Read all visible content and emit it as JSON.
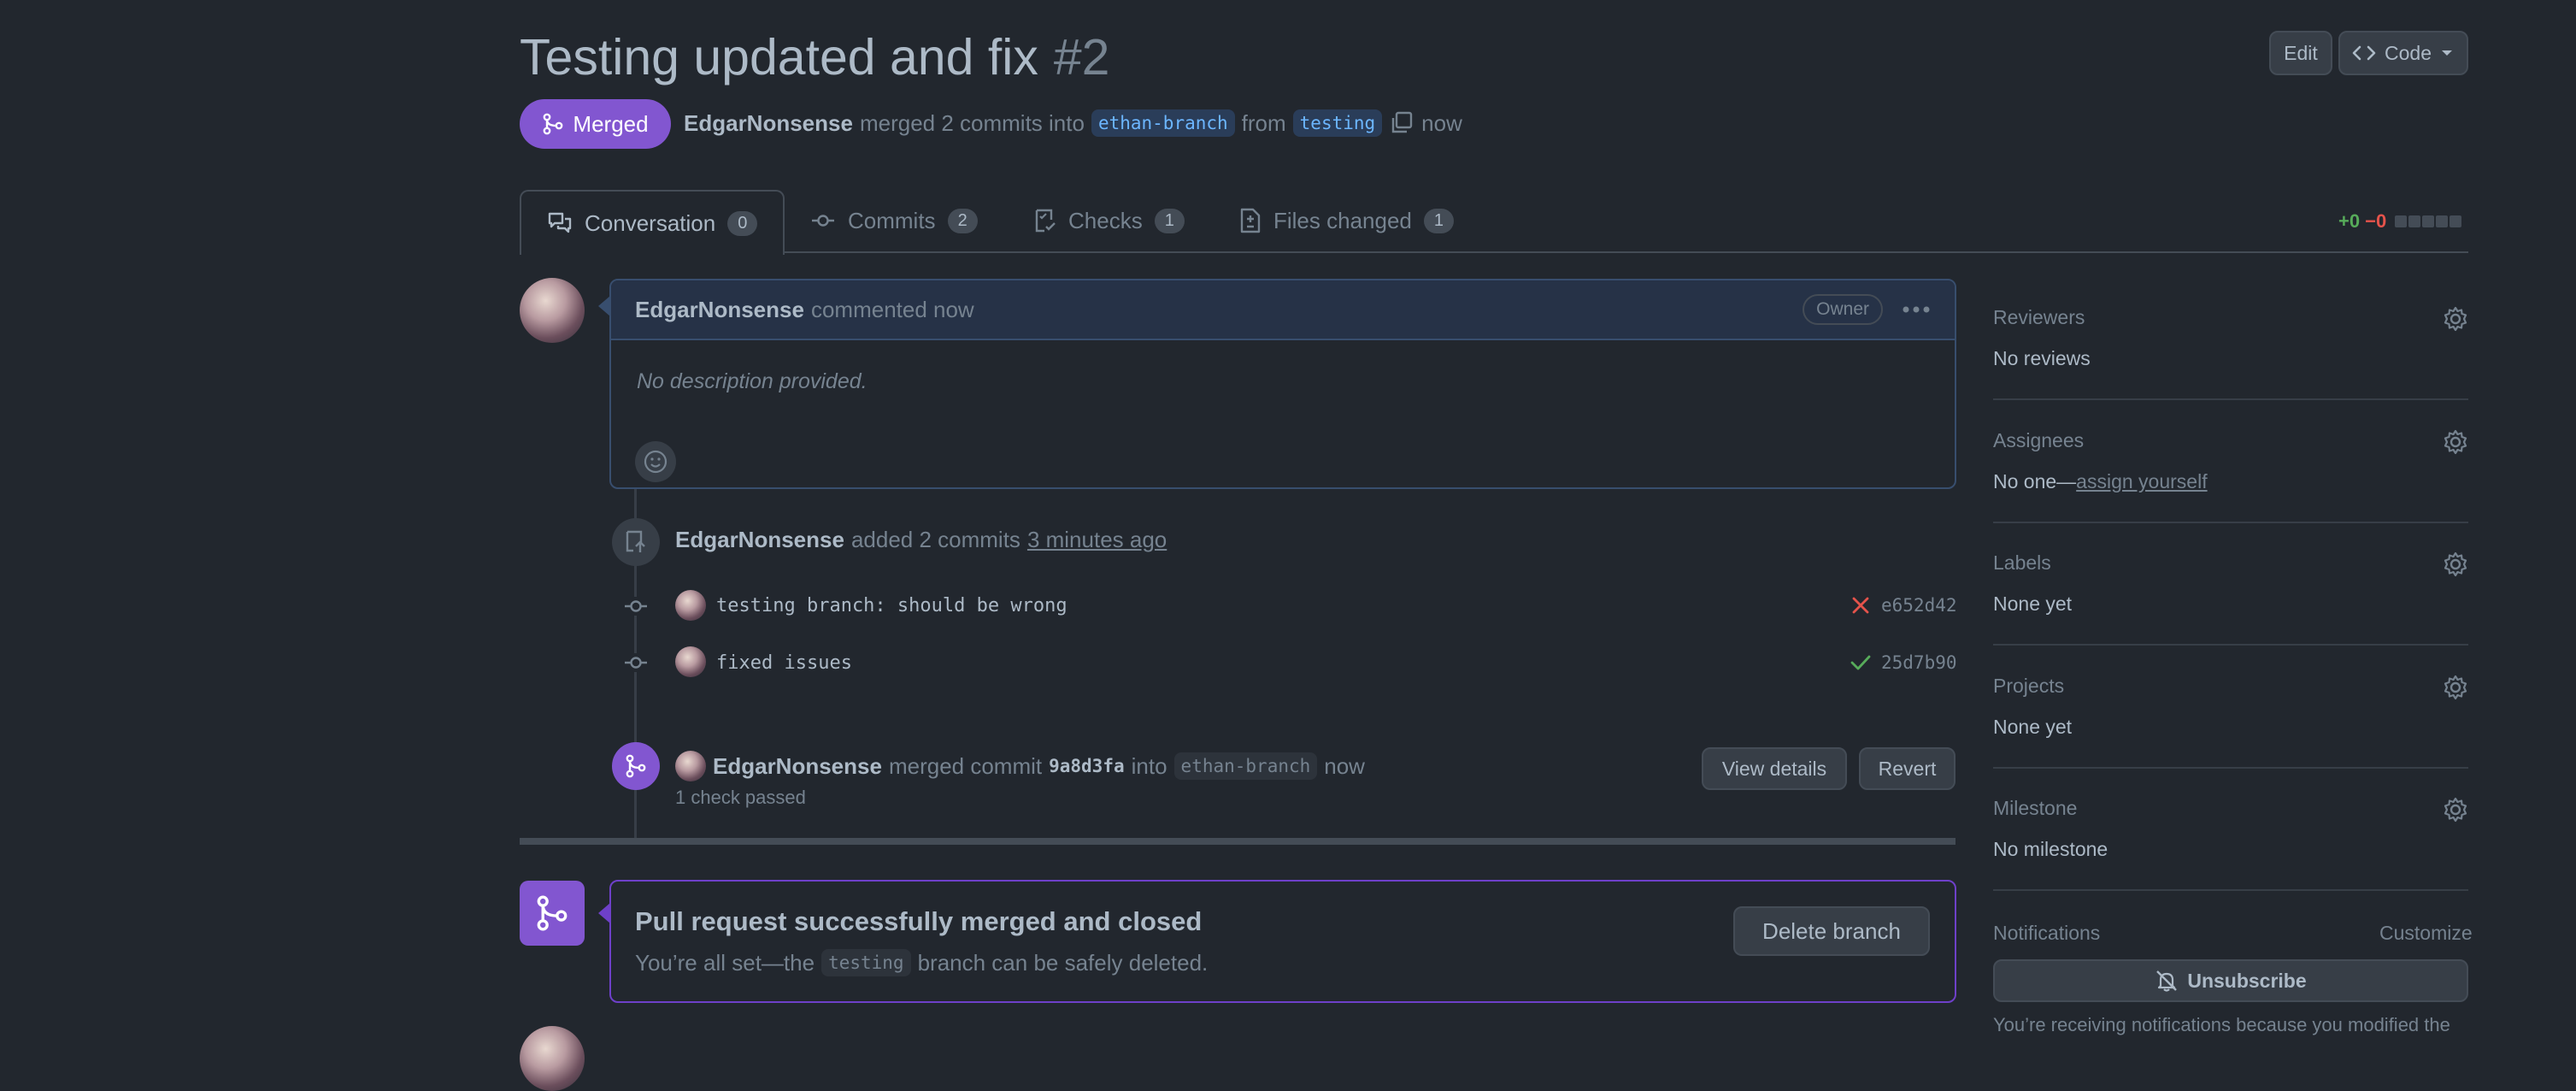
{
  "header": {
    "title": "Testing updated and fix",
    "number": "#2",
    "edit_label": "Edit",
    "code_label": "Code"
  },
  "state": {
    "badge": "Merged",
    "author": "EdgarNonsense",
    "action": "merged 2 commits into",
    "base_branch": "ethan-branch",
    "from": "from",
    "head_branch": "testing",
    "time": "now"
  },
  "tabs": [
    {
      "label": "Conversation",
      "count": "0",
      "icon": "comment-discussion-icon"
    },
    {
      "label": "Commits",
      "count": "2",
      "icon": "git-commit-icon"
    },
    {
      "label": "Checks",
      "count": "1",
      "icon": "checklist-icon"
    },
    {
      "label": "Files changed",
      "count": "1",
      "icon": "file-diff-icon"
    }
  ],
  "diffstat": {
    "additions": "+0",
    "deletions": "−0"
  },
  "comment": {
    "author": "EdgarNonsense",
    "meta": "commented now",
    "role": "Owner",
    "body": "No description provided."
  },
  "timeline": {
    "push_event": {
      "author": "EdgarNonsense",
      "action": "added 2 commits",
      "time": "3 minutes ago"
    },
    "commits": [
      {
        "message": "testing branch: should be wrong",
        "sha": "e652d42",
        "status": "failure",
        "status_color": "#e5534b"
      },
      {
        "message": "fixed issues",
        "sha": "25d7b90",
        "status": "success",
        "status_color": "#57ab5a"
      }
    ],
    "merge_event": {
      "author": "EdgarNonsense",
      "action": "merged commit",
      "commit": "9a8d3fa",
      "into": "into",
      "branch": "ethan-branch",
      "time": "now",
      "checks": "1 check passed",
      "view_details": "View details",
      "revert": "Revert"
    }
  },
  "merge_box": {
    "title": "Pull request successfully merged and closed",
    "sub_prefix": "You’re all set—the",
    "branch": "testing",
    "sub_suffix": "branch can be safely deleted.",
    "delete_label": "Delete branch"
  },
  "sidebar": {
    "reviewers": {
      "label": "Reviewers",
      "value": "No reviews"
    },
    "assignees": {
      "label": "Assignees",
      "value": "No one—",
      "link": "assign yourself"
    },
    "labels": {
      "label": "Labels",
      "value": "None yet"
    },
    "projects": {
      "label": "Projects",
      "value": "None yet"
    },
    "milestone": {
      "label": "Milestone",
      "value": "No milestone"
    },
    "notifications": {
      "label": "Notifications",
      "customize": "Customize",
      "unsubscribe": "Unsubscribe",
      "note": "You’re receiving notifications because you modified the"
    }
  },
  "colors": {
    "background": "#22272e",
    "merged_purple": "#8256d0",
    "link_blue": "#6cb6ff",
    "success_green": "#57ab5a",
    "danger_red": "#e5534b"
  }
}
